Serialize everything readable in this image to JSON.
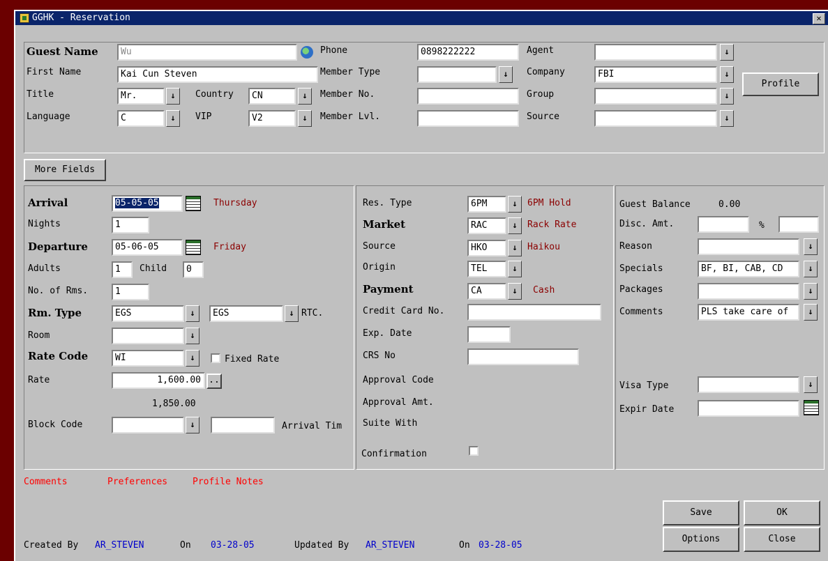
{
  "window": {
    "title": "GGHK - Reservation",
    "close_glyph": "✕"
  },
  "guest": {
    "guest_name_label": "Guest Name",
    "guest_name_value": "Wu",
    "first_name_label": "First Name",
    "first_name_value": "Kai Cun Steven",
    "title_label": "Title",
    "title_value": "Mr.",
    "country_label": "Country",
    "country_value": "CN",
    "language_label": "Language",
    "language_value": "C",
    "vip_label": "VIP",
    "vip_value": "V2",
    "phone_label": "Phone",
    "phone_value": "0898222222",
    "member_type_label": "Member Type",
    "member_type_value": "",
    "member_no_label": "Member No.",
    "member_no_value": "",
    "member_lvl_label": "Member Lvl.",
    "member_lvl_value": "",
    "agent_label": "Agent",
    "agent_value": "",
    "company_label": "Company",
    "company_value": "FBI",
    "group_label": "Group",
    "group_value": "",
    "source_label": "Source",
    "source_value": "",
    "profile_button": "Profile"
  },
  "more_fields_button": "More Fields",
  "stay": {
    "arrival_label": "Arrival",
    "arrival_value": "05-05-05",
    "arrival_day": "Thursday",
    "nights_label": "Nights",
    "nights_value": "1",
    "departure_label": "Departure",
    "departure_value": "05-06-05",
    "departure_day": "Friday",
    "adults_label": "Adults",
    "adults_value": "1",
    "child_label": "Child",
    "child_value": "0",
    "rooms_label": "No. of Rms.",
    "rooms_value": "1",
    "rm_type_label": "Rm. Type",
    "rm_type_value": "EGS",
    "rm_type_value2": "EGS",
    "rtc_label": "RTC.",
    "room_label": "Room",
    "room_value": "",
    "rate_code_label": "Rate Code",
    "rate_code_value": "WI",
    "fixed_rate_label": "Fixed Rate",
    "rate_label": "Rate",
    "rate_value": "1,600.00",
    "ellipsis": "..",
    "rate_total": "1,850.00",
    "block_code_label": "Block Code",
    "block_code_value": "",
    "arrival_time_label": "Arrival Tim"
  },
  "res": {
    "res_type_label": "Res. Type",
    "res_type_value": "6PM",
    "res_type_desc": "6PM Hold",
    "market_label": "Market",
    "market_value": "RAC",
    "market_desc": "Rack Rate",
    "source_label": "Source",
    "source_value": "HKO",
    "source_desc": "Haikou",
    "origin_label": "Origin",
    "origin_value": "TEL",
    "payment_label": "Payment",
    "payment_value": "CA",
    "payment_desc": "Cash",
    "cc_label": "Credit Card No.",
    "cc_value": "",
    "exp_label": "Exp. Date",
    "exp_value": "",
    "crs_label": "CRS No",
    "crs_value": "",
    "approval_code_label": "Approval Code",
    "approval_amt_label": "Approval Amt.",
    "suite_with_label": "Suite With",
    "confirmation_label": "Confirmation"
  },
  "balance": {
    "guest_balance_label": "Guest Balance",
    "guest_balance_value": "0.00",
    "disc_amt_label": "Disc. Amt.",
    "disc_amt_value": "",
    "pct_label": "%",
    "pct_value": "",
    "reason_label": "Reason",
    "reason_value": "",
    "specials_label": "Specials",
    "specials_value": "BF, BI, CAB, CD",
    "packages_label": "Packages",
    "packages_value": "",
    "comments_label": "Comments",
    "comments_value": "PLS take care of",
    "visa_type_label": "Visa Type",
    "visa_type_value": "",
    "expir_date_label": "Expir Date",
    "expir_date_value": ""
  },
  "links": {
    "comments": "Comments",
    "preferences": "Preferences",
    "profile_notes": "Profile Notes"
  },
  "footer": {
    "created_by_label": "Created By",
    "created_by_value": "AR_STEVEN",
    "on_label": "On",
    "created_on_value": "03-28-05",
    "updated_by_label": "Updated By",
    "updated_by_value": "AR_STEVEN",
    "on_label2": "On",
    "updated_on_value": "03-28-05"
  },
  "buttons": {
    "save": "Save",
    "ok": "OK",
    "options": "Options",
    "close": "Close"
  },
  "dropdown_glyph": "↓"
}
